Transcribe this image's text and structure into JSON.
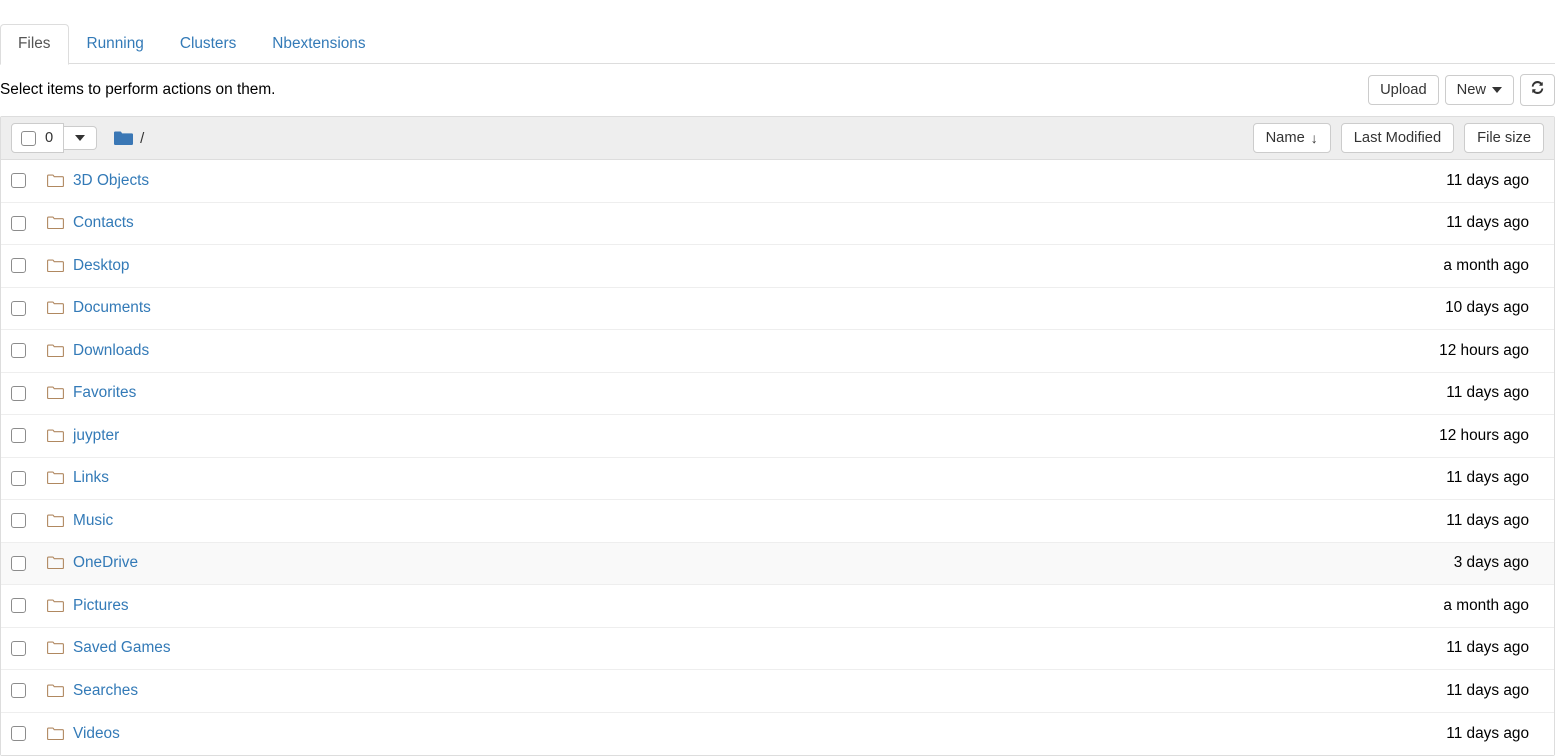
{
  "tabs": [
    {
      "label": "Files",
      "active": true
    },
    {
      "label": "Running",
      "active": false
    },
    {
      "label": "Clusters",
      "active": false
    },
    {
      "label": "Nbextensions",
      "active": false
    }
  ],
  "action_bar": {
    "message": "Select items to perform actions on them.",
    "upload_label": "Upload",
    "new_label": "New",
    "refresh_icon": "refresh-icon",
    "refresh_glyph": "↻"
  },
  "list_toolbar": {
    "select_count": "0",
    "select_all_checkbox_checked": false,
    "dropdown_icon": "chevron-down-icon",
    "breadcrumb_icon": "folder-icon",
    "breadcrumb_root": "/",
    "sort_name_label": "Name",
    "sort_name_direction_glyph": "↓",
    "sort_modified_label": "Last Modified",
    "sort_filesize_label": "File size"
  },
  "colors": {
    "link": "#337ab7",
    "toolbar_bg": "#eeeeee",
    "border": "#dddddd",
    "row_hover": "#f9f9f9",
    "folder_solid": "#3a77b5",
    "folder_outline": "#b08860",
    "tab_active_text": "#555555"
  },
  "files": [
    {
      "name": "3D Objects",
      "modified": "11 days ago",
      "icon": "folder-icon",
      "hovered": false
    },
    {
      "name": "Contacts",
      "modified": "11 days ago",
      "icon": "folder-icon",
      "hovered": false
    },
    {
      "name": "Desktop",
      "modified": "a month ago",
      "icon": "folder-icon",
      "hovered": false
    },
    {
      "name": "Documents",
      "modified": "10 days ago",
      "icon": "folder-icon",
      "hovered": false
    },
    {
      "name": "Downloads",
      "modified": "12 hours ago",
      "icon": "folder-icon",
      "hovered": false
    },
    {
      "name": "Favorites",
      "modified": "11 days ago",
      "icon": "folder-icon",
      "hovered": false
    },
    {
      "name": "juypter",
      "modified": "12 hours ago",
      "icon": "folder-icon",
      "hovered": false
    },
    {
      "name": "Links",
      "modified": "11 days ago",
      "icon": "folder-icon",
      "hovered": false
    },
    {
      "name": "Music",
      "modified": "11 days ago",
      "icon": "folder-icon",
      "hovered": false
    },
    {
      "name": "OneDrive",
      "modified": "3 days ago",
      "icon": "folder-icon",
      "hovered": true
    },
    {
      "name": "Pictures",
      "modified": "a month ago",
      "icon": "folder-icon",
      "hovered": false
    },
    {
      "name": "Saved Games",
      "modified": "11 days ago",
      "icon": "folder-icon",
      "hovered": false
    },
    {
      "name": "Searches",
      "modified": "11 days ago",
      "icon": "folder-icon",
      "hovered": false
    },
    {
      "name": "Videos",
      "modified": "11 days ago",
      "icon": "folder-icon",
      "hovered": false
    }
  ]
}
